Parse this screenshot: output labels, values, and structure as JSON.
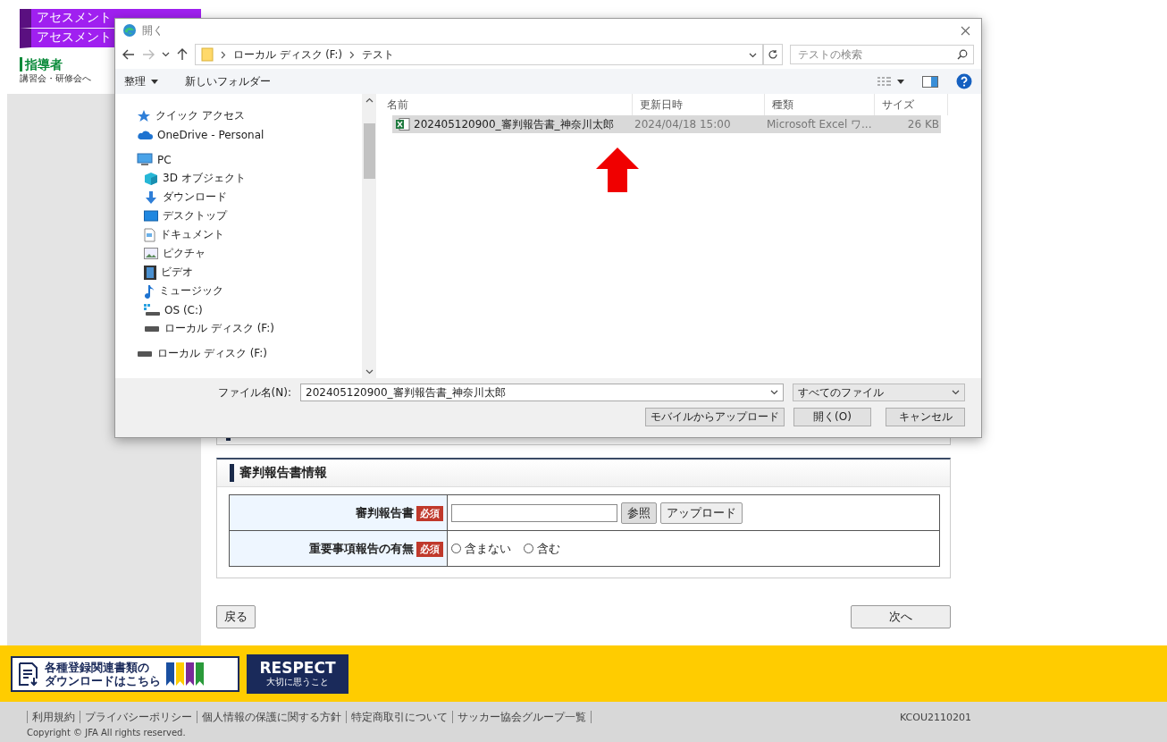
{
  "sidebar": {
    "menu_items": [
      {
        "label": "アセスメント"
      },
      {
        "label": "アセスメント"
      }
    ],
    "section_title": "指導者",
    "section_text": "講習会・研修会へ"
  },
  "form": {
    "title": "審判報告書情報",
    "rows": [
      {
        "kind": "file",
        "label": "審判報告書",
        "required_badge": "必須",
        "buttons": [
          "参照",
          "アップロード"
        ]
      },
      {
        "kind": "radio",
        "label": "重要事項報告の有無",
        "required_badge": "必須",
        "options": [
          {
            "label": "含まない",
            "selected": false
          },
          {
            "label": "含む",
            "selected": false
          }
        ]
      }
    ]
  },
  "nav_buttons": {
    "back": "戻る",
    "next": "次へ"
  },
  "banner": {
    "download_lines": [
      "各種登録関連書類の",
      "ダウンロードはこちら"
    ],
    "respect_title": "RESPECT",
    "respect_subtitle": "大切に思うこと"
  },
  "footer": {
    "links": [
      "利用規約",
      "プライバシーポリシー",
      "個人情報の保護に関する方針",
      "特定商取引について",
      "サッカー協会グループ一覧"
    ],
    "screen_code": "KCOU2110201",
    "copyright": "Copyright © JFA All rights reserved."
  },
  "dialog": {
    "title": "開く",
    "path": [
      "ローカル ディスク (F:)",
      "テスト"
    ],
    "search": {
      "placeholder": "テストの検索"
    },
    "toolbar": {
      "organize": "整理",
      "new_folder": "新しいフォルダー"
    },
    "nav": [
      {
        "label": "クイック アクセス",
        "kind": "star"
      },
      {
        "label": "OneDrive - Personal",
        "kind": "cloud"
      },
      {
        "label": "PC",
        "kind": "monitor",
        "children": [
          {
            "label": "3D オブジェクト",
            "kind": "cube"
          },
          {
            "label": "ダウンロード",
            "kind": "download"
          },
          {
            "label": "デスクトップ",
            "kind": "desktop"
          },
          {
            "label": "ドキュメント",
            "kind": "document"
          },
          {
            "label": "ピクチャ",
            "kind": "picture"
          },
          {
            "label": "ビデオ",
            "kind": "video"
          },
          {
            "label": "ミュージック",
            "kind": "music"
          },
          {
            "label": "OS (C:)",
            "kind": "os-drive"
          },
          {
            "label": "ローカル ディスク (F:)",
            "kind": "drive"
          }
        ]
      },
      {
        "label": "ローカル ディスク (F:)",
        "kind": "drive"
      }
    ],
    "columns": [
      "名前",
      "更新日時",
      "種類",
      "サイズ"
    ],
    "files": [
      {
        "name": "202405120900_審判報告書_神奈川太郎",
        "modified": "2024/04/18 15:00",
        "type": "Microsoft Excel ワ...",
        "size": "26 KB",
        "selected": true
      }
    ],
    "file_name_label": "ファイル名(N):",
    "file_name": "202405120900_審判報告書_神奈川太郎",
    "filter": "すべてのファイル",
    "buttons": [
      "モバイルからアップロード",
      "開く(O)",
      "キャンセル"
    ]
  }
}
